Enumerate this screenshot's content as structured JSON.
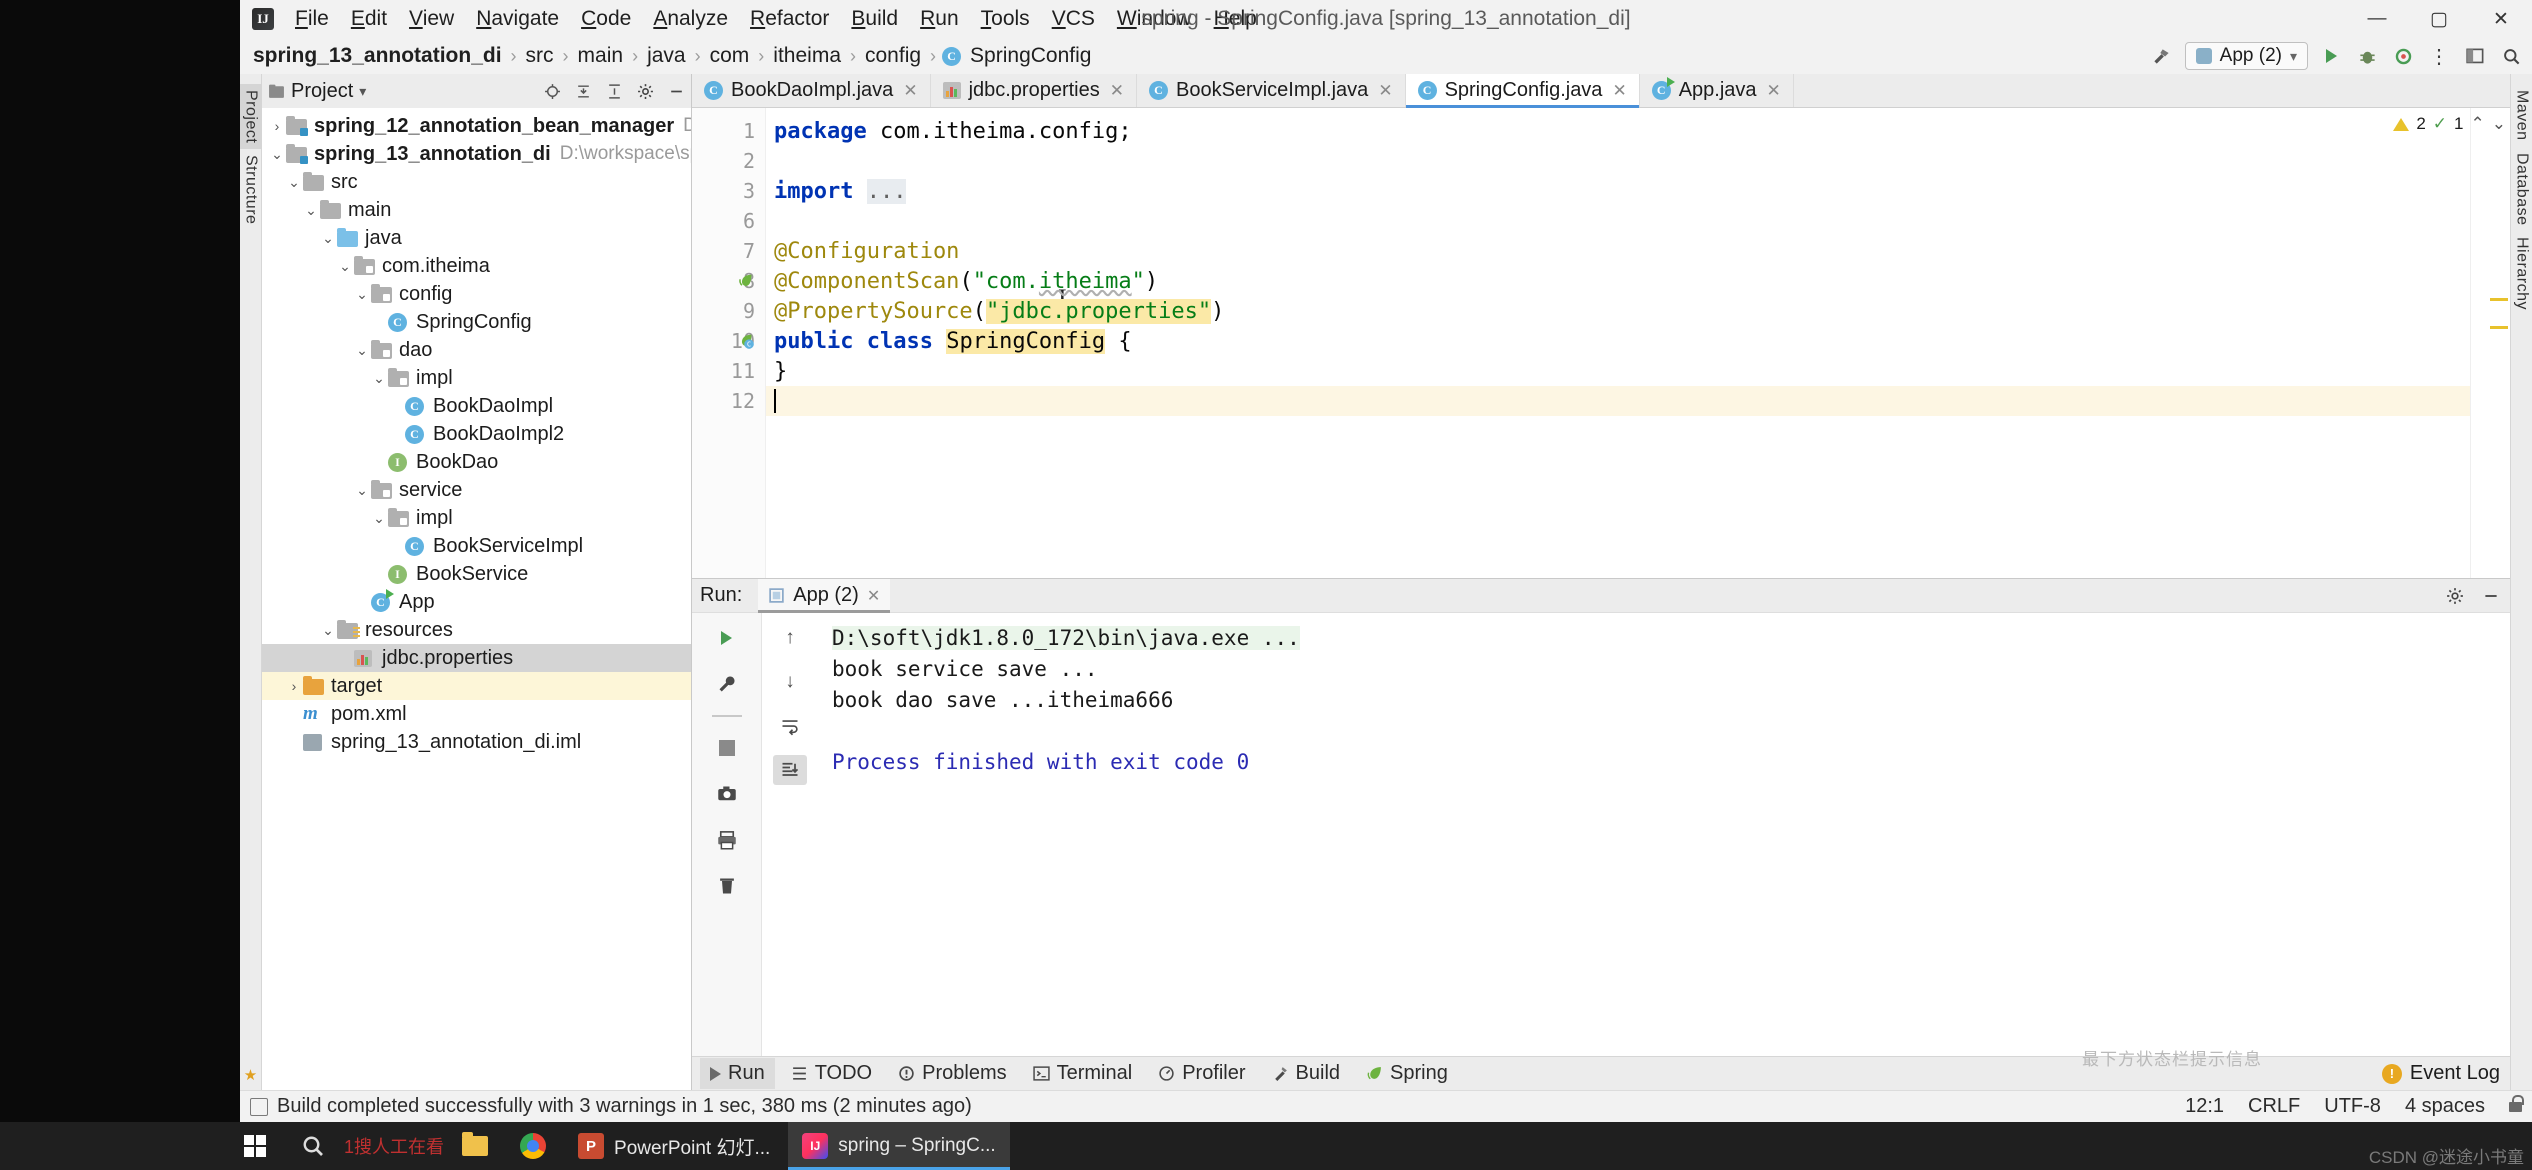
{
  "window": {
    "title": "spring - SpringConfig.java [spring_13_annotation_di]",
    "logo": "IJ",
    "minimize": "—",
    "maximize": "▢",
    "close": "✕"
  },
  "menubar": {
    "items": [
      {
        "label": "File"
      },
      {
        "label": "Edit"
      },
      {
        "label": "View"
      },
      {
        "label": "Navigate"
      },
      {
        "label": "Code"
      },
      {
        "label": "Analyze"
      },
      {
        "label": "Refactor"
      },
      {
        "label": "Build"
      },
      {
        "label": "Run"
      },
      {
        "label": "Tools"
      },
      {
        "label": "VCS"
      },
      {
        "label": "Window"
      },
      {
        "label": "Help"
      }
    ]
  },
  "breadcrumb": {
    "separator": "›",
    "items": [
      {
        "label": "spring_13_annotation_di",
        "bold": true
      },
      {
        "label": "src",
        "bold": false
      },
      {
        "label": "main",
        "bold": false
      },
      {
        "label": "java",
        "bold": false
      },
      {
        "label": "com",
        "bold": false
      },
      {
        "label": "itheima",
        "bold": false
      },
      {
        "label": "config",
        "bold": false
      },
      {
        "label": "SpringConfig",
        "bold": false,
        "icon": "class-icon"
      }
    ]
  },
  "navbar_right": {
    "hammer_icon": "build-hammer-icon",
    "run_config": "App (2)",
    "dropdown": "▾",
    "run_icon": "run-icon",
    "debug_icon": "debug-icon",
    "coverage_icon": "coverage-icon",
    "more_icon": "⋮",
    "layout_icon": "layout-icon",
    "search_icon": "search-icon"
  },
  "left_strip": {
    "tabs": [
      {
        "label": "Project",
        "active": true
      },
      {
        "label": "Structure",
        "active": false
      }
    ],
    "bottom": [
      {
        "label": "Favorites",
        "icon": "star-icon"
      }
    ]
  },
  "right_strip": {
    "tabs": [
      {
        "label": "Maven"
      },
      {
        "label": "Database"
      },
      {
        "label": "Hierarchy"
      }
    ]
  },
  "project_panel": {
    "title": "Project",
    "title_dropdown": "▾",
    "header_icons": [
      "locate-icon",
      "collapse-all-icon",
      "expand-icon",
      "settings-gear-icon",
      "hide-icon"
    ],
    "tree": [
      {
        "indent": 0,
        "twist": "›",
        "icon": "module-folder",
        "label": "spring_12_annotation_bean_manager",
        "bold": true,
        "path": "D:\\wo",
        "state": "normal"
      },
      {
        "indent": 0,
        "twist": "⌄",
        "icon": "module-folder",
        "label": "spring_13_annotation_di",
        "bold": true,
        "path": "D:\\workspace\\spri",
        "state": "normal"
      },
      {
        "indent": 1,
        "twist": "⌄",
        "icon": "folder",
        "label": "src",
        "bold": false,
        "path": "",
        "state": "normal"
      },
      {
        "indent": 2,
        "twist": "⌄",
        "icon": "folder",
        "label": "main",
        "bold": false,
        "path": "",
        "state": "normal"
      },
      {
        "indent": 3,
        "twist": "⌄",
        "icon": "folder-source",
        "label": "java",
        "bold": false,
        "path": "",
        "state": "normal"
      },
      {
        "indent": 4,
        "twist": "⌄",
        "icon": "package",
        "label": "com.itheima",
        "bold": false,
        "path": "",
        "state": "normal"
      },
      {
        "indent": 5,
        "twist": "⌄",
        "icon": "package",
        "label": "config",
        "bold": false,
        "path": "",
        "state": "normal"
      },
      {
        "indent": 6,
        "twist": "",
        "icon": "class",
        "label": "SpringConfig",
        "bold": false,
        "path": "",
        "state": "normal"
      },
      {
        "indent": 5,
        "twist": "⌄",
        "icon": "package",
        "label": "dao",
        "bold": false,
        "path": "",
        "state": "normal"
      },
      {
        "indent": 6,
        "twist": "⌄",
        "icon": "package",
        "label": "impl",
        "bold": false,
        "path": "",
        "state": "normal"
      },
      {
        "indent": 7,
        "twist": "",
        "icon": "class",
        "label": "BookDaoImpl",
        "bold": false,
        "path": "",
        "state": "normal"
      },
      {
        "indent": 7,
        "twist": "",
        "icon": "class",
        "label": "BookDaoImpl2",
        "bold": false,
        "path": "",
        "state": "normal"
      },
      {
        "indent": 6,
        "twist": "",
        "icon": "interface",
        "label": "BookDao",
        "bold": false,
        "path": "",
        "state": "normal"
      },
      {
        "indent": 5,
        "twist": "⌄",
        "icon": "package",
        "label": "service",
        "bold": false,
        "path": "",
        "state": "normal"
      },
      {
        "indent": 6,
        "twist": "⌄",
        "icon": "package",
        "label": "impl",
        "bold": false,
        "path": "",
        "state": "normal"
      },
      {
        "indent": 7,
        "twist": "",
        "icon": "class",
        "label": "BookServiceImpl",
        "bold": false,
        "path": "",
        "state": "normal"
      },
      {
        "indent": 6,
        "twist": "",
        "icon": "interface",
        "label": "BookService",
        "bold": false,
        "path": "",
        "state": "normal"
      },
      {
        "indent": 5,
        "twist": "",
        "icon": "class-runnable",
        "label": "App",
        "bold": false,
        "path": "",
        "state": "normal"
      },
      {
        "indent": 3,
        "twist": "⌄",
        "icon": "folder-resources",
        "label": "resources",
        "bold": false,
        "path": "",
        "state": "normal"
      },
      {
        "indent": 4,
        "twist": "",
        "icon": "properties",
        "label": "jdbc.properties",
        "bold": false,
        "path": "",
        "state": "selected"
      },
      {
        "indent": 1,
        "twist": "›",
        "icon": "folder-target",
        "label": "target",
        "bold": false,
        "path": "",
        "state": "highlight"
      },
      {
        "indent": 1,
        "twist": "",
        "icon": "maven",
        "label": "pom.xml",
        "bold": false,
        "path": "",
        "state": "normal"
      },
      {
        "indent": 1,
        "twist": "",
        "icon": "iml",
        "label": "spring_13_annotation_di.iml",
        "bold": false,
        "path": "",
        "state": "normal"
      }
    ]
  },
  "editor_tabs": [
    {
      "label": "BookDaoImpl.java",
      "icon": "class-icon",
      "active": false,
      "close": "✕"
    },
    {
      "label": "jdbc.properties",
      "icon": "properties-icon",
      "active": false,
      "close": "✕"
    },
    {
      "label": "BookServiceImpl.java",
      "icon": "class-icon",
      "active": false,
      "close": "✕"
    },
    {
      "label": "SpringConfig.java",
      "icon": "class-icon",
      "active": true,
      "close": "✕"
    },
    {
      "label": "App.java",
      "icon": "class-runnable-icon",
      "active": false,
      "close": "✕"
    }
  ],
  "editor": {
    "gutter_numbers": [
      "1",
      "2",
      "3",
      "6",
      "7",
      "8",
      "9",
      "10",
      "11",
      "12"
    ],
    "lines": [
      {
        "n": "1",
        "segments": [
          {
            "t": "package",
            "c": "kw"
          },
          {
            "t": " com.itheima.config;",
            "c": "pl"
          }
        ],
        "fold": "",
        "current": false
      },
      {
        "n": "2",
        "segments": [],
        "fold": "",
        "current": false
      },
      {
        "n": "3",
        "segments": [
          {
            "t": "import",
            "c": "kw"
          },
          {
            "t": " ",
            "c": "pl"
          },
          {
            "t": "...",
            "c": "dots"
          }
        ],
        "fold": "+",
        "current": false
      },
      {
        "n": "6",
        "segments": [],
        "fold": "",
        "current": false
      },
      {
        "n": "7",
        "segments": [
          {
            "t": "@Configuration",
            "c": "ann"
          }
        ],
        "fold": "-",
        "current": false
      },
      {
        "n": "8",
        "segments": [
          {
            "t": "@ComponentScan",
            "c": "ann"
          },
          {
            "t": "(",
            "c": "pl"
          },
          {
            "t": "\"com.",
            "c": "str"
          },
          {
            "t": "itheima",
            "c": "str wavy"
          },
          {
            "t": "\"",
            "c": "str"
          },
          {
            "t": ")",
            "c": "pl"
          }
        ],
        "fold": "",
        "current": false,
        "gutter_icon": "spring-bean-icon"
      },
      {
        "n": "9",
        "segments": [
          {
            "t": "@PropertySource",
            "c": "ann"
          },
          {
            "t": "(",
            "c": "pl"
          },
          {
            "t": "\"jdbc.properties\"",
            "c": "str hlbg"
          },
          {
            "t": ")",
            "c": "pl"
          }
        ],
        "fold": "-",
        "current": false
      },
      {
        "n": "10",
        "segments": [
          {
            "t": "public class",
            "c": "kw"
          },
          {
            "t": " ",
            "c": "pl"
          },
          {
            "t": "SpringConfig",
            "c": "pl hlbg"
          },
          {
            "t": " {",
            "c": "pl"
          }
        ],
        "fold": "",
        "current": false,
        "gutter_icon": "spring-config-icon"
      },
      {
        "n": "11",
        "segments": [
          {
            "t": "}",
            "c": "pl"
          }
        ],
        "fold": "",
        "current": false
      },
      {
        "n": "12",
        "segments": [],
        "fold": "",
        "current": true,
        "caret": true
      }
    ],
    "analysis": {
      "warning_count": "2",
      "check_count": "1",
      "up_arrow": "⌃",
      "down_arrow": "⌄"
    },
    "mouse_cursor": "I"
  },
  "run_panel": {
    "label": "Run:",
    "tab": "App (2)",
    "tab_close": "✕",
    "settings_icon": "gear-icon",
    "hide_icon": "minimize-icon",
    "toolbar_left": [
      "rerun-icon",
      "wrench-icon",
      "divider",
      "stop-icon",
      "camera-icon",
      "print-icon",
      "trash-icon"
    ],
    "toolbar_right": [
      "up-arrow-icon",
      "down-arrow-icon",
      "soft-wrap-icon",
      "scroll-to-end-icon"
    ],
    "console": [
      {
        "text": "D:\\soft\\jdk1.8.0_172\\bin\\java.exe ...",
        "style": "cmd"
      },
      {
        "text": "book service save ...",
        "style": "plain"
      },
      {
        "text": "book dao save ...itheima666",
        "style": "plain"
      },
      {
        "text": "",
        "style": "plain"
      },
      {
        "text": "Process finished with exit code 0",
        "style": "fin"
      }
    ]
  },
  "bottom_tabs": [
    {
      "label": "Run",
      "icon": "run-icon",
      "active": true
    },
    {
      "label": "TODO",
      "icon": "todo-icon",
      "active": false
    },
    {
      "label": "Problems",
      "icon": "problems-icon",
      "active": false
    },
    {
      "label": "Terminal",
      "icon": "terminal-icon",
      "active": false
    },
    {
      "label": "Profiler",
      "icon": "profiler-icon",
      "active": false
    },
    {
      "label": "Build",
      "icon": "build-icon",
      "active": false
    },
    {
      "label": "Spring",
      "icon": "spring-leaf-icon",
      "active": false
    }
  ],
  "event_log": {
    "label": "Event Log",
    "icon": "notification-icon"
  },
  "statusbar": {
    "message": "Build completed successfully with 3 warnings in 1 sec, 380 ms (2 minutes ago)",
    "icon": "build-status-icon",
    "caret_position": "12:1",
    "line_separator": "CRLF",
    "encoding": "UTF-8",
    "indent": "4 spaces",
    "lock": "lock-icon"
  },
  "taskbar": {
    "start": "windows-start-icon",
    "search_text": "1搜人工在看",
    "items": [
      {
        "label": "PowerPoint 幻灯...",
        "icon": "powerpoint-icon",
        "active": false
      },
      {
        "label": "spring – SpringC...",
        "icon": "intellij-icon",
        "active": true
      }
    ]
  },
  "watermarks": {
    "bottom_right": "CSDN @迷途小书童",
    "center": "最下方状态栏提示信息"
  },
  "colors": {
    "accent_blue": "#4a90d9",
    "keyword": "#0033b3",
    "annotation": "#9e880d",
    "string": "#067d17",
    "highlight": "#fbe9a7",
    "selection": "#d4d4d4",
    "warning": "#e8c22c",
    "success": "#4f9e4f"
  }
}
